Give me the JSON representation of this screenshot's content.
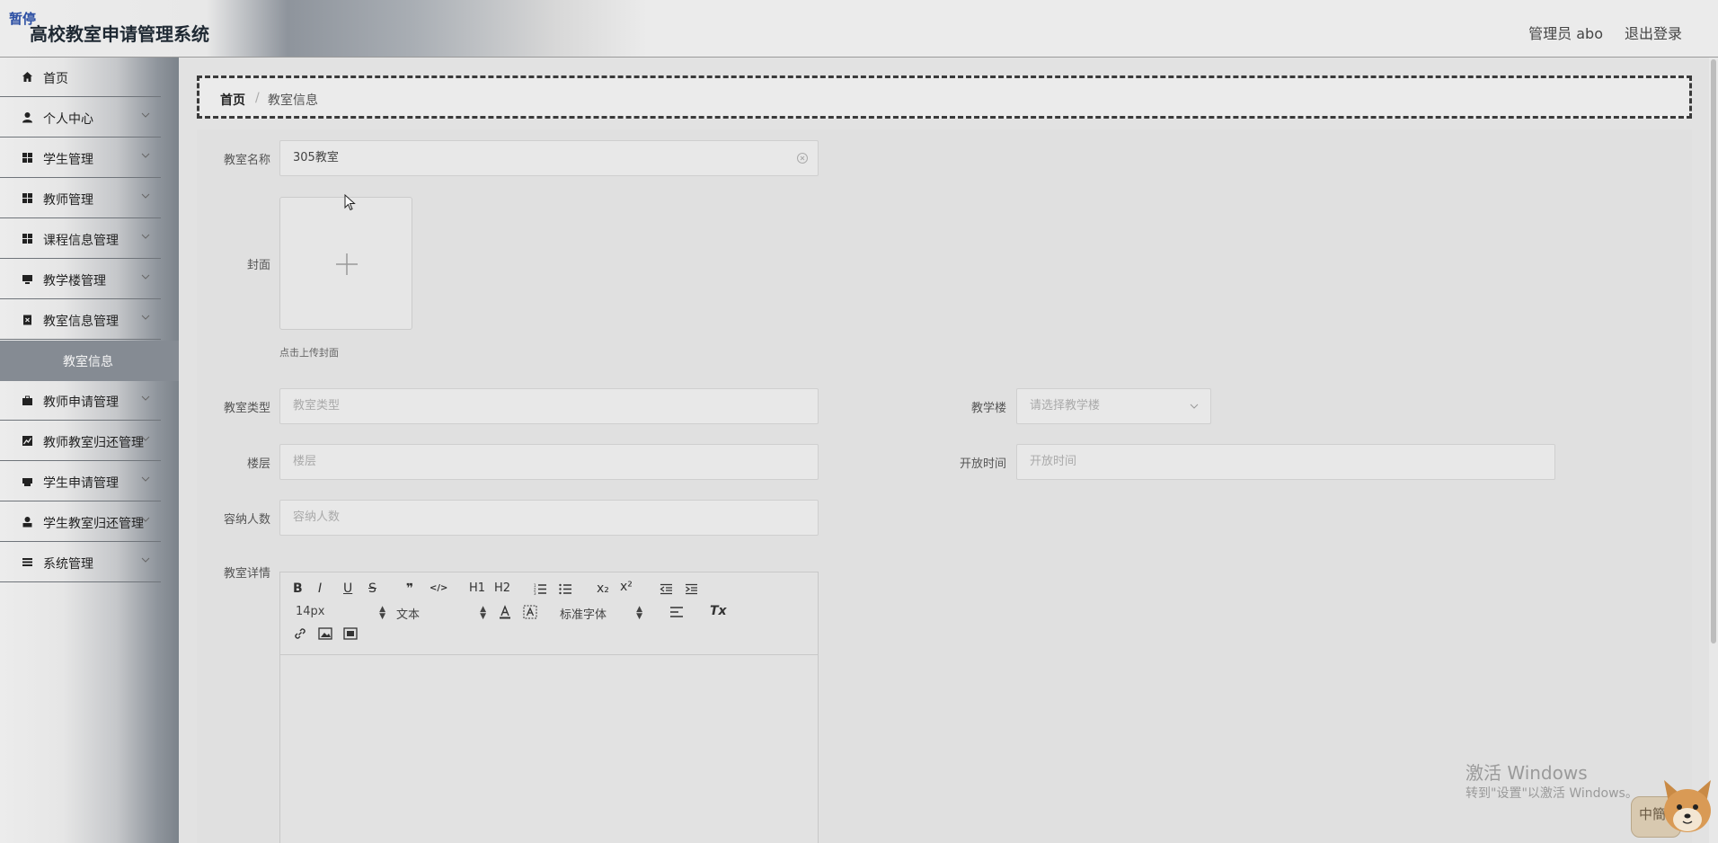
{
  "header": {
    "badge": "暂停",
    "title": "高校教室申请管理系统",
    "user_label": "管理员 abo",
    "logout_label": "退出登录"
  },
  "sidebar": {
    "items": [
      {
        "label": "首页",
        "icon": "home-icon",
        "has_children": false
      },
      {
        "label": "个人中心",
        "icon": "user-icon",
        "has_children": true
      },
      {
        "label": "学生管理",
        "icon": "grid-icon",
        "has_children": true
      },
      {
        "label": "教师管理",
        "icon": "grid-icon",
        "has_children": true
      },
      {
        "label": "课程信息管理",
        "icon": "grid-icon",
        "has_children": true
      },
      {
        "label": "教学楼管理",
        "icon": "monitor-icon",
        "has_children": true
      },
      {
        "label": "教室信息管理",
        "icon": "clipboard-icon",
        "has_children": true
      },
      {
        "label": "教师申请管理",
        "icon": "briefcase-icon",
        "has_children": true
      },
      {
        "label": "教师教室归还管理",
        "icon": "chart-icon",
        "has_children": true
      },
      {
        "label": "学生申请管理",
        "icon": "printer-icon",
        "has_children": true
      },
      {
        "label": "学生教室归还管理",
        "icon": "person-icon",
        "has_children": true
      },
      {
        "label": "系统管理",
        "icon": "list-icon",
        "has_children": true
      }
    ],
    "active_sub": "教室信息"
  },
  "breadcrumb": {
    "home": "首页",
    "separator": "/",
    "current": "教室信息"
  },
  "form": {
    "name": {
      "label": "教室名称",
      "value": "305教室"
    },
    "cover": {
      "label": "封面",
      "hint": "点击上传封面"
    },
    "type": {
      "label": "教室类型",
      "placeholder": "教室类型"
    },
    "building": {
      "label": "教学楼",
      "placeholder": "请选择教学楼"
    },
    "floor": {
      "label": "楼层",
      "placeholder": "楼层"
    },
    "open_time": {
      "label": "开放时间",
      "placeholder": "开放时间"
    },
    "capacity": {
      "label": "容纳人数",
      "placeholder": "容纳人数"
    },
    "detail": {
      "label": "教室详情"
    }
  },
  "editor": {
    "buttons": {
      "bold": "B",
      "italic": "I",
      "underline": "U",
      "strike": "S",
      "quote": "❞",
      "code": "</>",
      "h1": "H1",
      "h2": "H2",
      "sub": "x₂",
      "sup": "x²",
      "clear": "Tx"
    },
    "size_select": "14px",
    "header_select": "文本",
    "font_select": "标准字体"
  },
  "watermark": {
    "line1": "激活 Windows",
    "line2": "转到\"设置\"以激活 Windows。"
  },
  "ime": {
    "label": "中簡"
  },
  "colors": {
    "accent": "#858b93",
    "brand_badge": "#2c4fa3"
  }
}
